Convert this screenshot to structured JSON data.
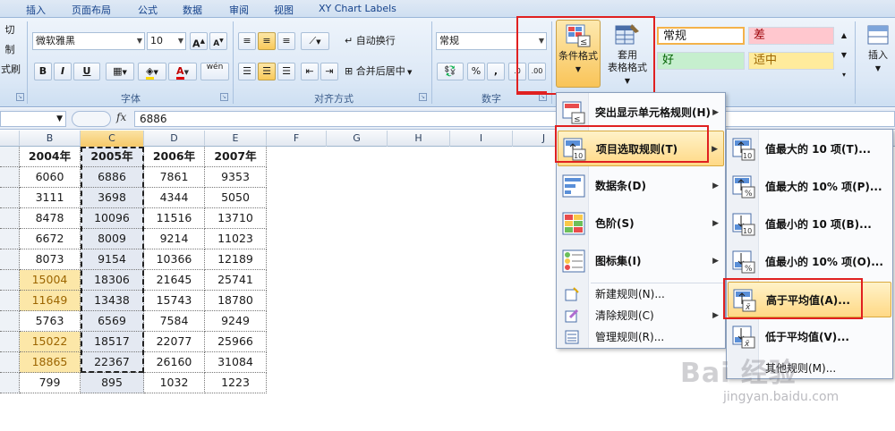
{
  "tabs": [
    "插入",
    "页面布局",
    "公式",
    "数据",
    "审阅",
    "视图",
    "XY Chart Labels"
  ],
  "clipboard": {
    "cut_label": "切",
    "copy_label": "制",
    "format_painter_label": "式刷"
  },
  "font": {
    "name": "微软雅黑",
    "size": "10",
    "grow_label": "A",
    "shrink_label": "A",
    "bold": "B",
    "italic": "I",
    "underline": "U",
    "font_color_label": "A",
    "phonetic_label": "wén",
    "group_label": "字体"
  },
  "alignment": {
    "wrap_label": "自动换行",
    "merge_label": "合并后居中",
    "group_label": "对齐方式"
  },
  "number": {
    "format": "常规",
    "percent": "%",
    "comma": ",",
    "group_label": "数字"
  },
  "styles": {
    "conditional_label_1": "条件格式",
    "table_label_1": "套用",
    "table_label_2": "表格格式",
    "normal": "常规",
    "bad": "差",
    "good": "好",
    "neutral": "适中"
  },
  "cells_group": {
    "insert_label": "插入"
  },
  "formula_bar": {
    "fx": "fx",
    "value": "6886"
  },
  "columns": [
    "B",
    "C",
    "D",
    "E",
    "F",
    "G",
    "H",
    "I",
    "J"
  ],
  "table": {
    "headers": [
      "2004年",
      "2005年",
      "2006年",
      "2007年"
    ],
    "rows": [
      [
        "6060",
        "6886",
        "7861",
        "9353"
      ],
      [
        "3111",
        "3698",
        "4344",
        "5050"
      ],
      [
        "8478",
        "10096",
        "11516",
        "13710"
      ],
      [
        "6672",
        "8009",
        "9214",
        "11023"
      ],
      [
        "8073",
        "9154",
        "10366",
        "12189"
      ],
      [
        "15004",
        "18306",
        "21645",
        "25741"
      ],
      [
        "11649",
        "13438",
        "15743",
        "18780"
      ],
      [
        "5763",
        "6569",
        "7584",
        "9249"
      ],
      [
        "15022",
        "18517",
        "22077",
        "25966"
      ],
      [
        "18865",
        "22367",
        "26160",
        "31084"
      ],
      [
        "799",
        "895",
        "1032",
        "1223"
      ]
    ]
  },
  "cf_menu": {
    "items": [
      {
        "label": "突出显示单元格规则(H)"
      },
      {
        "label": "项目选取规则(T)"
      },
      {
        "label": "数据条(D)"
      },
      {
        "label": "色阶(S)"
      },
      {
        "label": "图标集(I)"
      }
    ],
    "small_items": [
      {
        "label": "新建规则(N)..."
      },
      {
        "label": "清除规则(C)"
      },
      {
        "label": "管理规则(R)..."
      }
    ]
  },
  "topbottom_menu": {
    "items": [
      {
        "label": "值最大的 10 项(T)..."
      },
      {
        "label": "值最大的 10% 项(P)..."
      },
      {
        "label": "值最小的 10 项(B)..."
      },
      {
        "label": "值最小的 10% 项(O)..."
      },
      {
        "label": "高于平均值(A)..."
      },
      {
        "label": "低于平均值(V)..."
      }
    ],
    "more_label": "其他规则(M)..."
  },
  "watermark": {
    "text": "Bai 经验",
    "sub": "jingyan.baidu.com"
  },
  "colors": {
    "highlight_red": "#e02020",
    "yellow_fill": "#fce7a8",
    "yellow_text": "#9c6500",
    "accent": "#15428b"
  }
}
